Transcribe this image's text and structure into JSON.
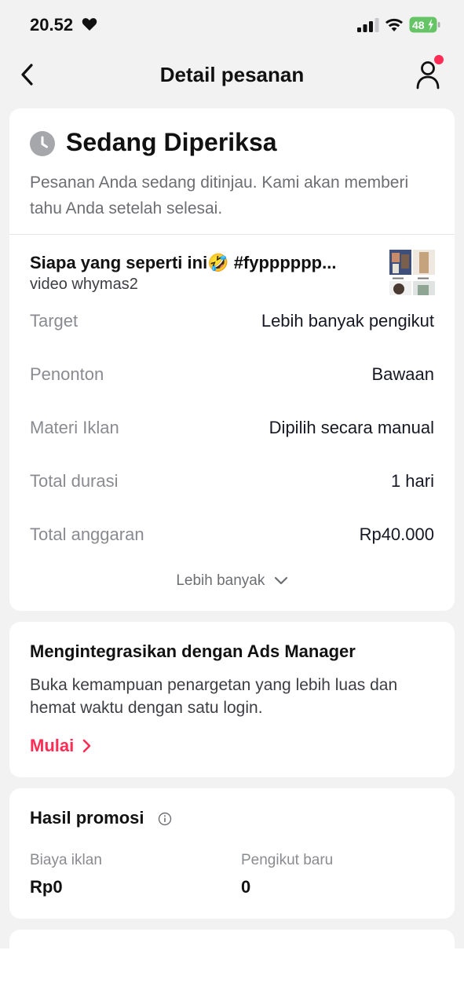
{
  "status_bar": {
    "time": "20.52",
    "battery": "48"
  },
  "header": {
    "title": "Detail pesanan"
  },
  "order": {
    "status_title": "Sedang Diperiksa",
    "status_desc": "Pesanan Anda sedang ditinjau. Kami akan memberi tahu Anda setelah selesai.",
    "video_title": "Siapa yang seperti ini🤣 #fypppppp...",
    "video_sub": "video whymas2",
    "details": [
      {
        "key": "Target",
        "value": "Lebih banyak pengikut"
      },
      {
        "key": "Penonton",
        "value": "Bawaan"
      },
      {
        "key": "Materi Iklan",
        "value": "Dipilih secara manual"
      },
      {
        "key": "Total durasi",
        "value": "1 hari"
      },
      {
        "key": "Total anggaran",
        "value": "Rp40.000"
      }
    ],
    "more_label": "Lebih banyak"
  },
  "ads_manager": {
    "title": "Mengintegrasikan dengan Ads Manager",
    "desc": "Buka kemampuan penargetan yang lebih luas dan hemat waktu dengan satu login.",
    "link_label": "Mulai"
  },
  "results": {
    "title": "Hasil promosi",
    "metrics": [
      {
        "label": "Biaya iklan",
        "value": "Rp0"
      },
      {
        "label": "Pengikut baru",
        "value": "0"
      }
    ]
  },
  "colors": {
    "accent": "#fe2c55",
    "background": "#f2f2f2",
    "battery_green": "#65c466"
  },
  "icons": [
    "heart-icon",
    "signal-icon",
    "wifi-icon",
    "battery-icon",
    "back-arrow-icon",
    "user-icon",
    "notification-dot-icon",
    "clock-icon",
    "video-thumbnail",
    "chevron-down-icon",
    "chevron-right-icon",
    "info-icon"
  ]
}
